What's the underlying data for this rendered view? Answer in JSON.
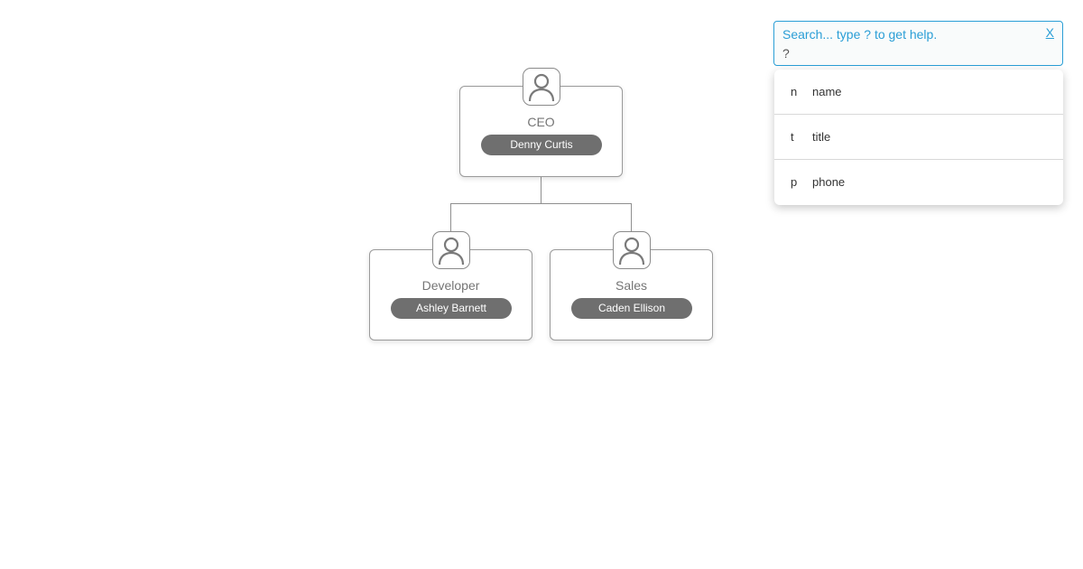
{
  "org_chart": {
    "nodes": [
      {
        "id": "ceo",
        "title": "CEO",
        "name": "Denny Curtis",
        "icon": "person-icon"
      },
      {
        "id": "developer",
        "title": "Developer",
        "name": "Ashley Barnett",
        "icon": "person-icon"
      },
      {
        "id": "sales",
        "title": "Sales",
        "name": "Caden Ellison",
        "icon": "person-icon"
      }
    ]
  },
  "search": {
    "placeholder": "Search... type ? to get help.",
    "value": "?",
    "close_label": "X",
    "help_items": [
      {
        "key": "n",
        "label": "name"
      },
      {
        "key": "t",
        "label": "title"
      },
      {
        "key": "p",
        "label": "phone"
      }
    ]
  },
  "colors": {
    "accent": "#2a9ed6",
    "name_pill": "#6f6f6f",
    "node_border": "#9a9a9a"
  }
}
